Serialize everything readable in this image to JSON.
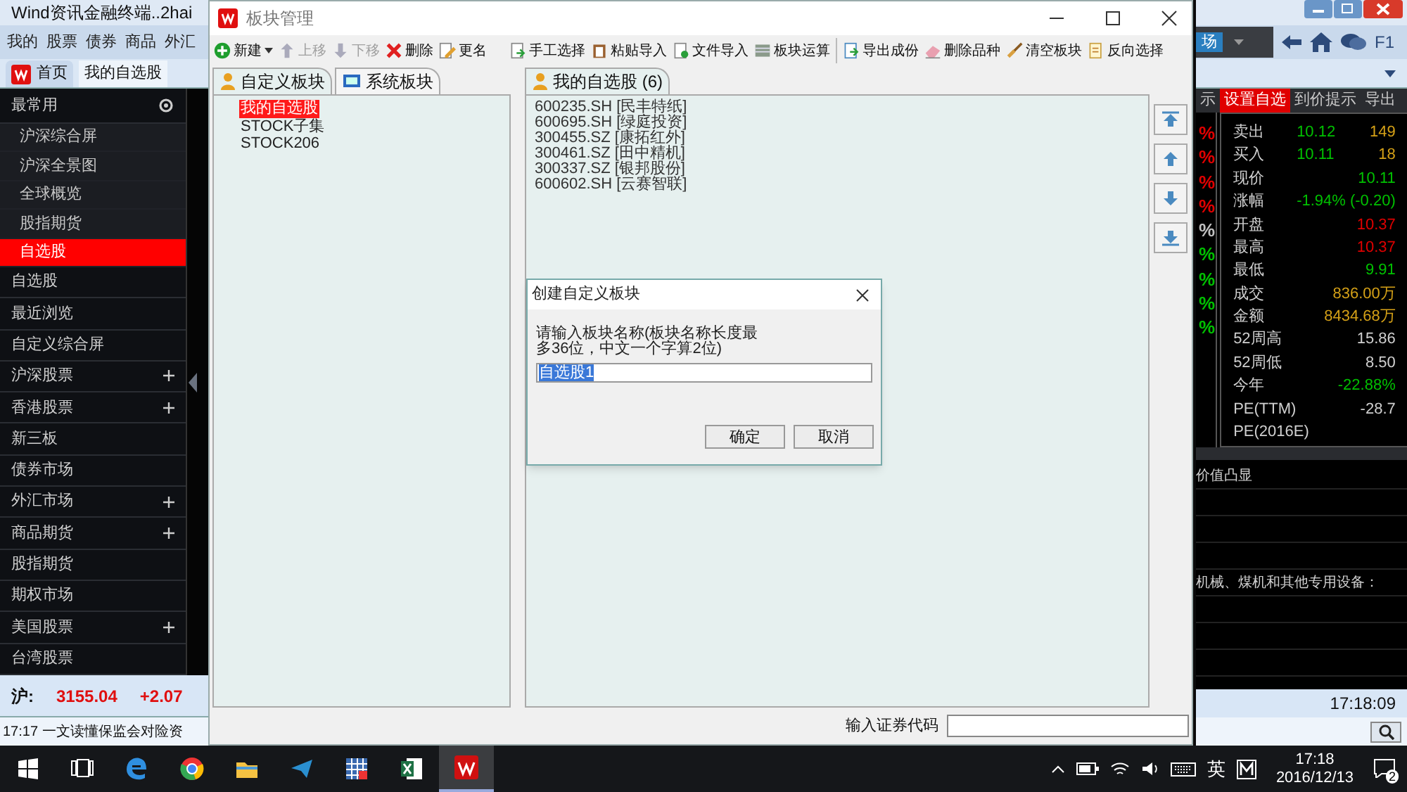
{
  "main_window": {
    "title": "Wind资讯金融终端..2hai",
    "menu": [
      "我的",
      "股票",
      "债券",
      "商品",
      "外汇"
    ],
    "tabs": [
      {
        "label": "首页",
        "selected": false
      },
      {
        "label": "我的自选股",
        "selected": true
      }
    ],
    "sidebar": [
      {
        "label": "最常用",
        "selected": false,
        "expandable": false,
        "children": [
          {
            "label": "沪深综合屏",
            "selected": false
          },
          {
            "label": "沪深全景图",
            "selected": false
          },
          {
            "label": "全球概览",
            "selected": false
          },
          {
            "label": "股指期货",
            "selected": false
          },
          {
            "label": "自选股",
            "selected": true
          }
        ]
      },
      {
        "label": "自选股",
        "selected": false,
        "expandable": false
      },
      {
        "label": "最近浏览",
        "selected": false,
        "expandable": false
      },
      {
        "label": "自定义综合屏",
        "selected": false,
        "expandable": false
      },
      {
        "label": "沪深股票",
        "selected": false,
        "expandable": true
      },
      {
        "label": "香港股票",
        "selected": false,
        "expandable": true
      },
      {
        "label": "新三板",
        "selected": false,
        "expandable": false
      },
      {
        "label": "债券市场",
        "selected": false,
        "expandable": false
      },
      {
        "label": "外汇市场",
        "selected": false,
        "expandable": true
      },
      {
        "label": "商品期货",
        "selected": false,
        "expandable": true
      },
      {
        "label": "股指期货",
        "selected": false,
        "expandable": false
      },
      {
        "label": "期权市场",
        "selected": false,
        "expandable": false
      },
      {
        "label": "美国股票",
        "selected": false,
        "expandable": true
      },
      {
        "label": "台湾股票",
        "selected": false,
        "expandable": false
      }
    ],
    "index_bar": {
      "name": "沪:",
      "value": "3155.04",
      "change": "+2.07"
    },
    "news": "17:17 一文读懂保监会对险资"
  },
  "right_panel": {
    "market_button": "场",
    "help": "F1",
    "tabs": [
      {
        "label": "示",
        "selected": false
      },
      {
        "label": "设置自选",
        "selected": true
      },
      {
        "label": "到价提示",
        "selected": false
      },
      {
        "label": "导出",
        "selected": false
      }
    ],
    "changes": [
      {
        "text": "%",
        "color": "#e00000"
      },
      {
        "text": "%",
        "color": "#e00000"
      },
      {
        "text": "%",
        "color": "#e00000"
      },
      {
        "text": "%",
        "color": "#e00000"
      },
      {
        "text": "%",
        "color": "#c0c0c0"
      },
      {
        "text": "%",
        "color": "#00c000"
      },
      {
        "text": "%",
        "color": "#00c000"
      },
      {
        "text": "%",
        "color": "#00c000"
      },
      {
        "text": "%",
        "color": "#00c000"
      }
    ],
    "quote": [
      {
        "label": "卖出",
        "values": [
          {
            "text": "10.12",
            "color": "#00c000"
          },
          {
            "text": "149",
            "color": "#d4a017"
          }
        ]
      },
      {
        "label": "买入",
        "values": [
          {
            "text": "10.11",
            "color": "#00c000"
          },
          {
            "text": "18",
            "color": "#d4a017"
          }
        ]
      },
      {
        "label": "现价",
        "values": [
          {
            "text": "10.11",
            "color": "#00c000"
          }
        ]
      },
      {
        "label": "涨幅",
        "values": [
          {
            "text": "-1.94% (-0.20)",
            "color": "#00c000"
          }
        ]
      },
      {
        "label": "开盘",
        "values": [
          {
            "text": "10.37",
            "color": "#e00000"
          }
        ]
      },
      {
        "label": "最高",
        "values": [
          {
            "text": "10.37",
            "color": "#e00000"
          }
        ]
      },
      {
        "label": "最低",
        "values": [
          {
            "text": "9.91",
            "color": "#00c000"
          }
        ]
      },
      {
        "label": "成交",
        "values": [
          {
            "text": "836.00万",
            "color": "#d4a017"
          }
        ]
      },
      {
        "label": "金额",
        "values": [
          {
            "text": "8434.68万",
            "color": "#d4a017"
          }
        ]
      },
      {
        "label": "52周高",
        "values": [
          {
            "text": "15.86",
            "color": "#d0d0d0"
          }
        ]
      },
      {
        "label": "52周低",
        "values": [
          {
            "text": "8.50",
            "color": "#d0d0d0"
          }
        ]
      },
      {
        "label": "今年",
        "values": [
          {
            "text": "-22.88%",
            "color": "#00c000"
          }
        ]
      },
      {
        "label": "PE(TTM)",
        "values": [
          {
            "text": "-28.7",
            "color": "#d0d0d0"
          }
        ]
      },
      {
        "label": "PE(2016E)"
      }
    ],
    "news_lines": [
      "价值凸显",
      "机械、煤机和其他专用设备："
    ],
    "clock": "17:18:09"
  },
  "block_manager": {
    "title": "板块管理",
    "toolbar": [
      {
        "items": [
          {
            "label": "新建",
            "kind": "new",
            "disabled": false,
            "has_menu": true
          },
          {
            "label": "上移",
            "kind": "up",
            "disabled": true,
            "has_menu": false
          },
          {
            "label": "下移",
            "kind": "down",
            "disabled": true,
            "has_menu": false
          },
          {
            "label": "删除",
            "kind": "delete",
            "disabled": false,
            "has_menu": false
          },
          {
            "label": "更名",
            "kind": "rename",
            "disabled": false,
            "has_menu": false
          }
        ]
      },
      {
        "items": [
          {
            "label": "手工选择",
            "kind": "pick",
            "disabled": false,
            "has_menu": false
          },
          {
            "label": "粘贴导入",
            "kind": "paste",
            "disabled": false,
            "has_menu": false
          },
          {
            "label": "文件导入",
            "kind": "file",
            "disabled": false,
            "has_menu": false
          },
          {
            "label": "板块运算",
            "kind": "calc",
            "disabled": false,
            "has_menu": false
          }
        ]
      },
      {
        "items": [
          {
            "label": "导出成份",
            "kind": "export",
            "disabled": false,
            "has_menu": false
          },
          {
            "label": "删除品种",
            "kind": "remove",
            "disabled": false,
            "has_menu": false
          },
          {
            "label": "清空板块",
            "kind": "clear",
            "disabled": false,
            "has_menu": false
          },
          {
            "label": "反向选择",
            "kind": "invert",
            "disabled": false,
            "has_menu": false
          }
        ]
      }
    ],
    "left_tabs": [
      {
        "label": "自定义板块",
        "kind": "person",
        "selected": true
      },
      {
        "label": "系统板块",
        "kind": "monitor",
        "selected": false
      }
    ],
    "blocks": [
      {
        "label": "我的自选股",
        "selected": true
      },
      {
        "label": "STOCK子集",
        "selected": false
      },
      {
        "label": "STOCK206",
        "selected": false
      }
    ],
    "right_tab": "我的自选股 (6)",
    "stocks": [
      "600235.SH [民丰特纸]",
      "600695.SH [绿庭投资]",
      "300455.SZ [康拓红外]",
      "300461.SZ [田中精机]",
      "300337.SZ [银邦股份]",
      "600602.SH [云赛智联]"
    ],
    "code_label": "输入证券代码"
  },
  "dialog": {
    "title": "创建自定义板块",
    "prompt": "请输入板块名称(板块名称长度最多36位，中文一个字算2位)",
    "value": "自选股1",
    "buttons": [
      "确定",
      "取消"
    ]
  },
  "taskbar": {
    "apps": [
      {
        "kind": "start",
        "selected": false
      },
      {
        "kind": "taskview",
        "selected": false
      },
      {
        "kind": "edge",
        "selected": false
      },
      {
        "kind": "chrome",
        "selected": false
      },
      {
        "kind": "folder",
        "selected": false
      },
      {
        "kind": "plane",
        "selected": false
      },
      {
        "kind": "grid",
        "selected": false
      },
      {
        "kind": "excel",
        "selected": false
      },
      {
        "kind": "wind",
        "selected": true
      }
    ],
    "ime": "英",
    "time": "17:18",
    "date": "2016/12/13",
    "notifications": "2"
  }
}
